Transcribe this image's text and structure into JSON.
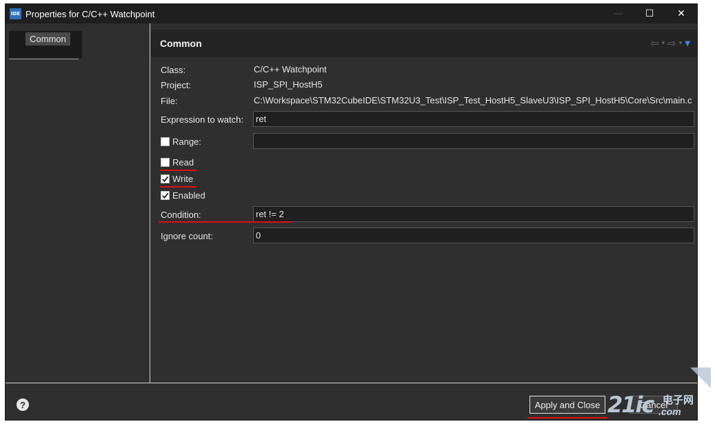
{
  "window": {
    "title": "Properties for C/C++ Watchpoint",
    "app_icon_text": "IDE",
    "controls": {
      "minimize": "—",
      "maximize": "☐",
      "close": "✕"
    }
  },
  "sidebar": {
    "items": [
      {
        "label": "Common",
        "selected": true
      }
    ]
  },
  "main": {
    "title": "Common",
    "nav": {
      "back": "⇦",
      "forward": "⇨",
      "caret": "▾",
      "menu": "▼"
    },
    "info": {
      "class_label": "Class:",
      "class_value": "C/C++ Watchpoint",
      "project_label": "Project:",
      "project_value": "ISP_SPI_HostH5",
      "file_label": "File:",
      "file_value": "C:\\Workspace\\STM32CubeIDE\\STM32U3_Test\\ISP_Test_HostH5_SlaveU3\\ISP_SPI_HostH5\\Core\\Src\\main.c"
    },
    "expression": {
      "label": "Expression to watch:",
      "value": "ret"
    },
    "range": {
      "label": "Range:",
      "checked": false,
      "value": ""
    },
    "read": {
      "label": "Read",
      "checked": false
    },
    "write": {
      "label": "Write",
      "checked": true
    },
    "enabled": {
      "label": "Enabled",
      "checked": true
    },
    "condition": {
      "label": "Condition:",
      "value": "ret != 2"
    },
    "ignore_count": {
      "label": "Ignore count:",
      "value": "0"
    }
  },
  "footer": {
    "help_icon": "?",
    "apply_close_label": "Apply and Close",
    "cancel_label": "Cancel"
  },
  "watermark": {
    "logo": "21ic",
    "cn": "电子网",
    "domain": ".com"
  },
  "colors": {
    "annotation_red": "#e01010",
    "menu_caret_blue": "#3d8ee8",
    "dark_bg": "#2f2f2f"
  }
}
